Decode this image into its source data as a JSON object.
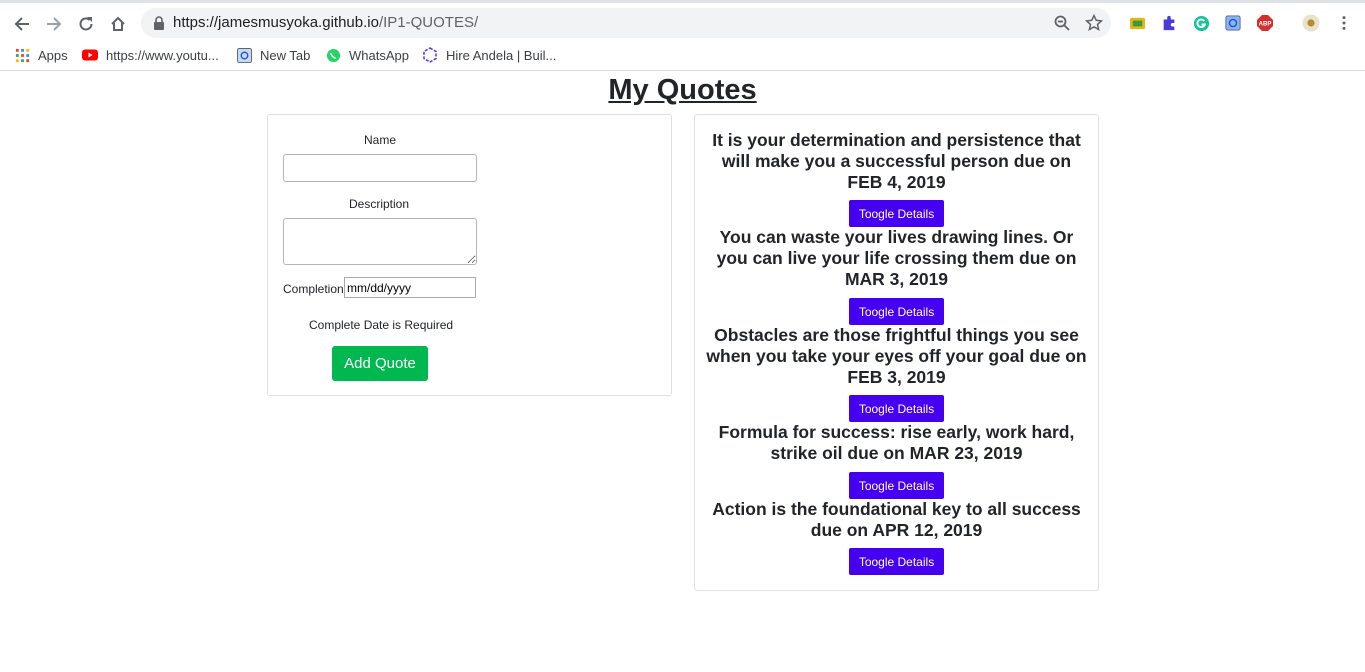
{
  "browser": {
    "url_host": "https://jamesmusyoka.github.io",
    "url_path": "/IP1-QUOTES/",
    "bookmarks": [
      {
        "label": "Apps",
        "icon": "apps-grid-icon"
      },
      {
        "label": "https://www.youtu...",
        "icon": "youtube-icon"
      },
      {
        "label": "New Tab",
        "icon": "newtab-icon"
      },
      {
        "label": "WhatsApp",
        "icon": "whatsapp-icon"
      },
      {
        "label": "Hire Andela | Buil...",
        "icon": "andela-icon"
      }
    ]
  },
  "page": {
    "title": "My Quotes"
  },
  "form": {
    "name_label": "Name",
    "name_value": "",
    "description_label": "Description",
    "description_value": "",
    "completion_label": "Completion",
    "completion_placeholder": "mm/dd/yyyy",
    "validation_message": "Complete Date is Required",
    "submit_label": "Add Quote"
  },
  "quotes": [
    {
      "text": "It is your determination and persistence that will make you a successful person due on FEB 4, 2019",
      "button": "Toogle Details"
    },
    {
      "text": "You can waste your lives drawing lines. Or you can live your life crossing them due on MAR 3, 2019",
      "button": "Toogle Details"
    },
    {
      "text": "Obstacles are those frightful things you see when you take your eyes off your goal due on FEB 3, 2019",
      "button": "Toogle Details"
    },
    {
      "text": "Formula for success: rise early, work hard, strike oil due on MAR 23, 2019",
      "button": "Toogle Details"
    },
    {
      "text": "Action is the foundational key to all success due on APR 12, 2019",
      "button": "Toogle Details"
    }
  ],
  "colors": {
    "add_button": "#00b84f",
    "toggle_button": "#4500f0"
  }
}
